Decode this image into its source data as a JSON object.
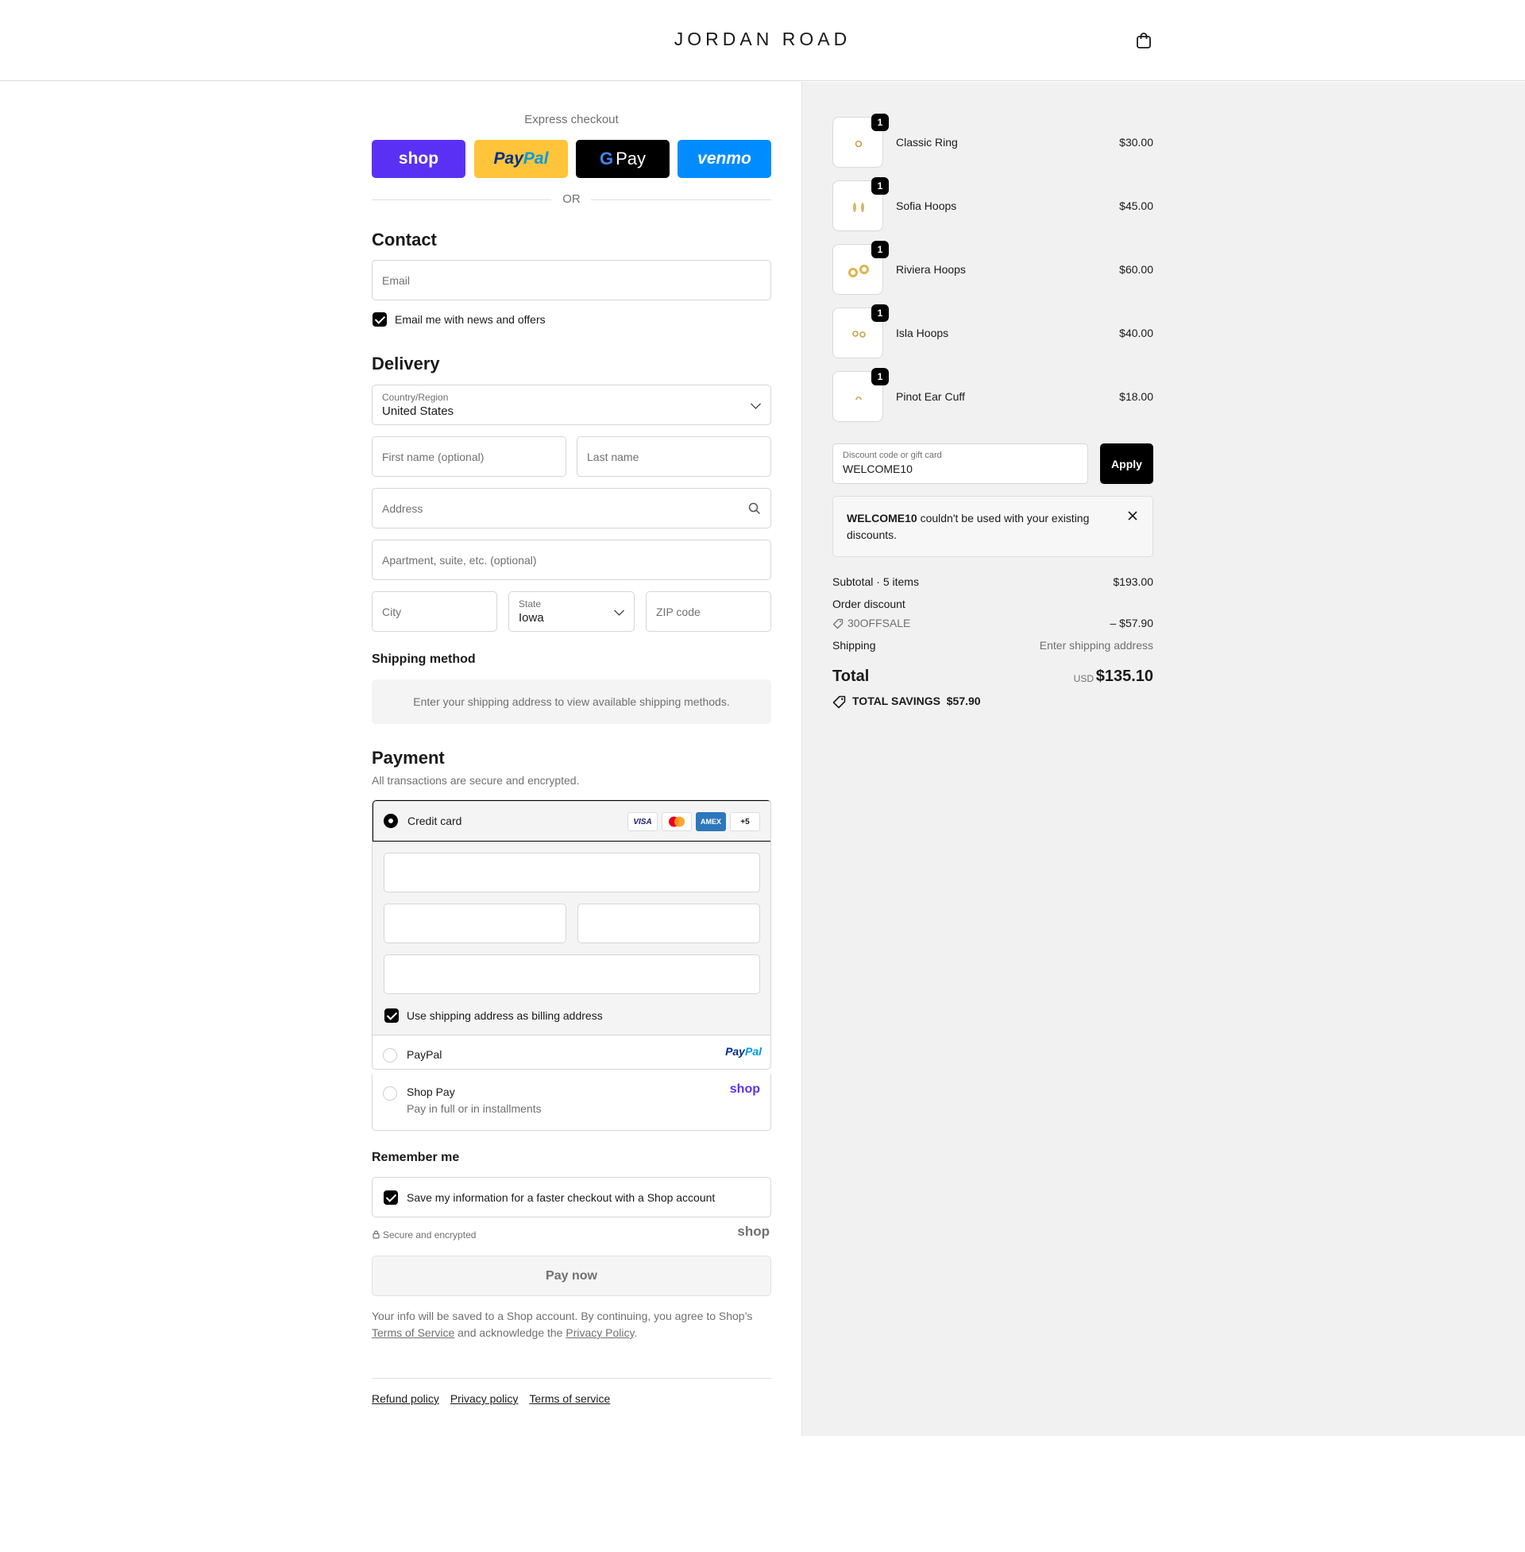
{
  "header": {
    "brand": "JORDAN ROAD",
    "cart_icon": "shopping-bag-icon"
  },
  "express": {
    "title": "Express checkout",
    "buttons": [
      {
        "label": "shop",
        "color": "#5a31f4"
      },
      {
        "label_a": "Pay",
        "label_b": "Pal",
        "color": "#ffc439"
      },
      {
        "label_g": "G",
        "label": "Pay",
        "color": "#000000"
      },
      {
        "label": "venmo",
        "color": "#008cff"
      }
    ],
    "or_text": "OR"
  },
  "contact": {
    "heading": "Contact",
    "email_placeholder": "Email",
    "news_label": "Email me with news and offers",
    "news_checked": true
  },
  "delivery": {
    "heading": "Delivery",
    "country_label": "Country/Region",
    "country_value": "United States",
    "first_name_placeholder": "First name (optional)",
    "last_name_placeholder": "Last name",
    "address_placeholder": "Address",
    "apartment_placeholder": "Apartment, suite, etc. (optional)",
    "city_placeholder": "City",
    "state_label": "State",
    "state_value": "Iowa",
    "zip_placeholder": "ZIP code"
  },
  "shipping_method": {
    "heading": "Shipping method",
    "notice": "Enter your shipping address to view available shipping methods."
  },
  "payment": {
    "heading": "Payment",
    "subtitle": "All transactions are secure and encrypted.",
    "credit_card_label": "Credit card",
    "card_logos": [
      "VISA",
      "AMEX",
      "+5"
    ],
    "billing_label": "Use shipping address as billing address",
    "paypal_label": "PayPal",
    "paypal_logo_a": "Pay",
    "paypal_logo_b": "Pal",
    "shoppay_label": "Shop Pay",
    "shoppay_sub": "Pay in full or in installments",
    "shop_logo": "shop"
  },
  "remember": {
    "heading": "Remember me",
    "save_label": "Save my information for a faster checkout with a Shop account",
    "secure_label": "Secure and encrypted",
    "shop_logo": "shop"
  },
  "pay_button": "Pay now",
  "legal": {
    "line1": "Your info will be saved to a Shop account. By continuing, you agree to Shop’s",
    "terms_link": "Terms of Service",
    "middle": "and acknowledge the",
    "privacy_link": "Privacy Policy",
    "end": "."
  },
  "footer_links": [
    "Refund policy",
    "Privacy policy",
    "Terms of service"
  ],
  "cart": {
    "items": [
      {
        "name": "Classic Ring",
        "price": "$30.00",
        "qty": "1"
      },
      {
        "name": "Sofia Hoops",
        "price": "$45.00",
        "qty": "1"
      },
      {
        "name": "Riviera Hoops",
        "price": "$60.00",
        "qty": "1"
      },
      {
        "name": "Isla Hoops",
        "price": "$40.00",
        "qty": "1"
      },
      {
        "name": "Pinot Ear Cuff",
        "price": "$18.00",
        "qty": "1"
      }
    ],
    "discount_label": "Discount code or gift card",
    "discount_value": "WELCOME10",
    "apply": "Apply",
    "error_code": "WELCOME10",
    "error_text": "couldn't be used with your existing discounts.",
    "subtotal_label": "Subtotal · 5 items",
    "subtotal_value": "$193.00",
    "order_discount_label": "Order discount",
    "discount_code": "30OFFSALE",
    "discount_amount": "– $57.90",
    "shipping_label": "Shipping",
    "shipping_value": "Enter shipping address",
    "total_label": "Total",
    "currency": "USD",
    "total_value": "$135.10",
    "savings_label": "TOTAL SAVINGS",
    "savings_value": "$57.90"
  }
}
